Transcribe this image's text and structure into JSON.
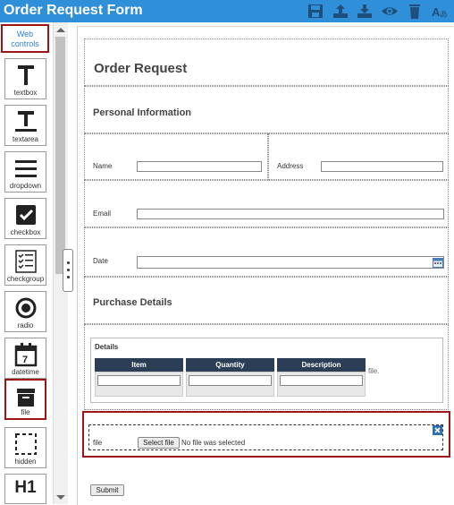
{
  "app": {
    "title": "Order Request Form"
  },
  "toolbar": {
    "icons": [
      "save-icon",
      "upload-icon",
      "download-icon",
      "preview-icon",
      "delete-icon",
      "translate-icon"
    ]
  },
  "sidebar": {
    "header_label": "Web controls",
    "tools": [
      {
        "label": "textbox"
      },
      {
        "label": "textarea"
      },
      {
        "label": "dropdown"
      },
      {
        "label": "checkbox"
      },
      {
        "label": "checkgroup"
      },
      {
        "label": "radio"
      },
      {
        "label": "datetime"
      },
      {
        "label": "file"
      },
      {
        "label": "hidden"
      },
      {
        "label": ""
      }
    ],
    "heading_tool_glyph": "H1",
    "datetime_glyph": "7"
  },
  "form": {
    "title": "Order Request",
    "section1": "Personal Information",
    "name_label": "Name",
    "address_label": "Address",
    "email_label": "Email",
    "date_label": "Date",
    "section2": "Purchase Details",
    "details": {
      "label": "Details",
      "columns": [
        "Item",
        "Quantity",
        "Description"
      ],
      "trailing": "file."
    },
    "file": {
      "label": "file",
      "button": "Select file",
      "status": "No file was selected"
    },
    "submit": "Submit"
  },
  "colors": {
    "titlebar": "#2f8fd8",
    "selection": "#a01515",
    "table_header": "#2b3e55"
  }
}
